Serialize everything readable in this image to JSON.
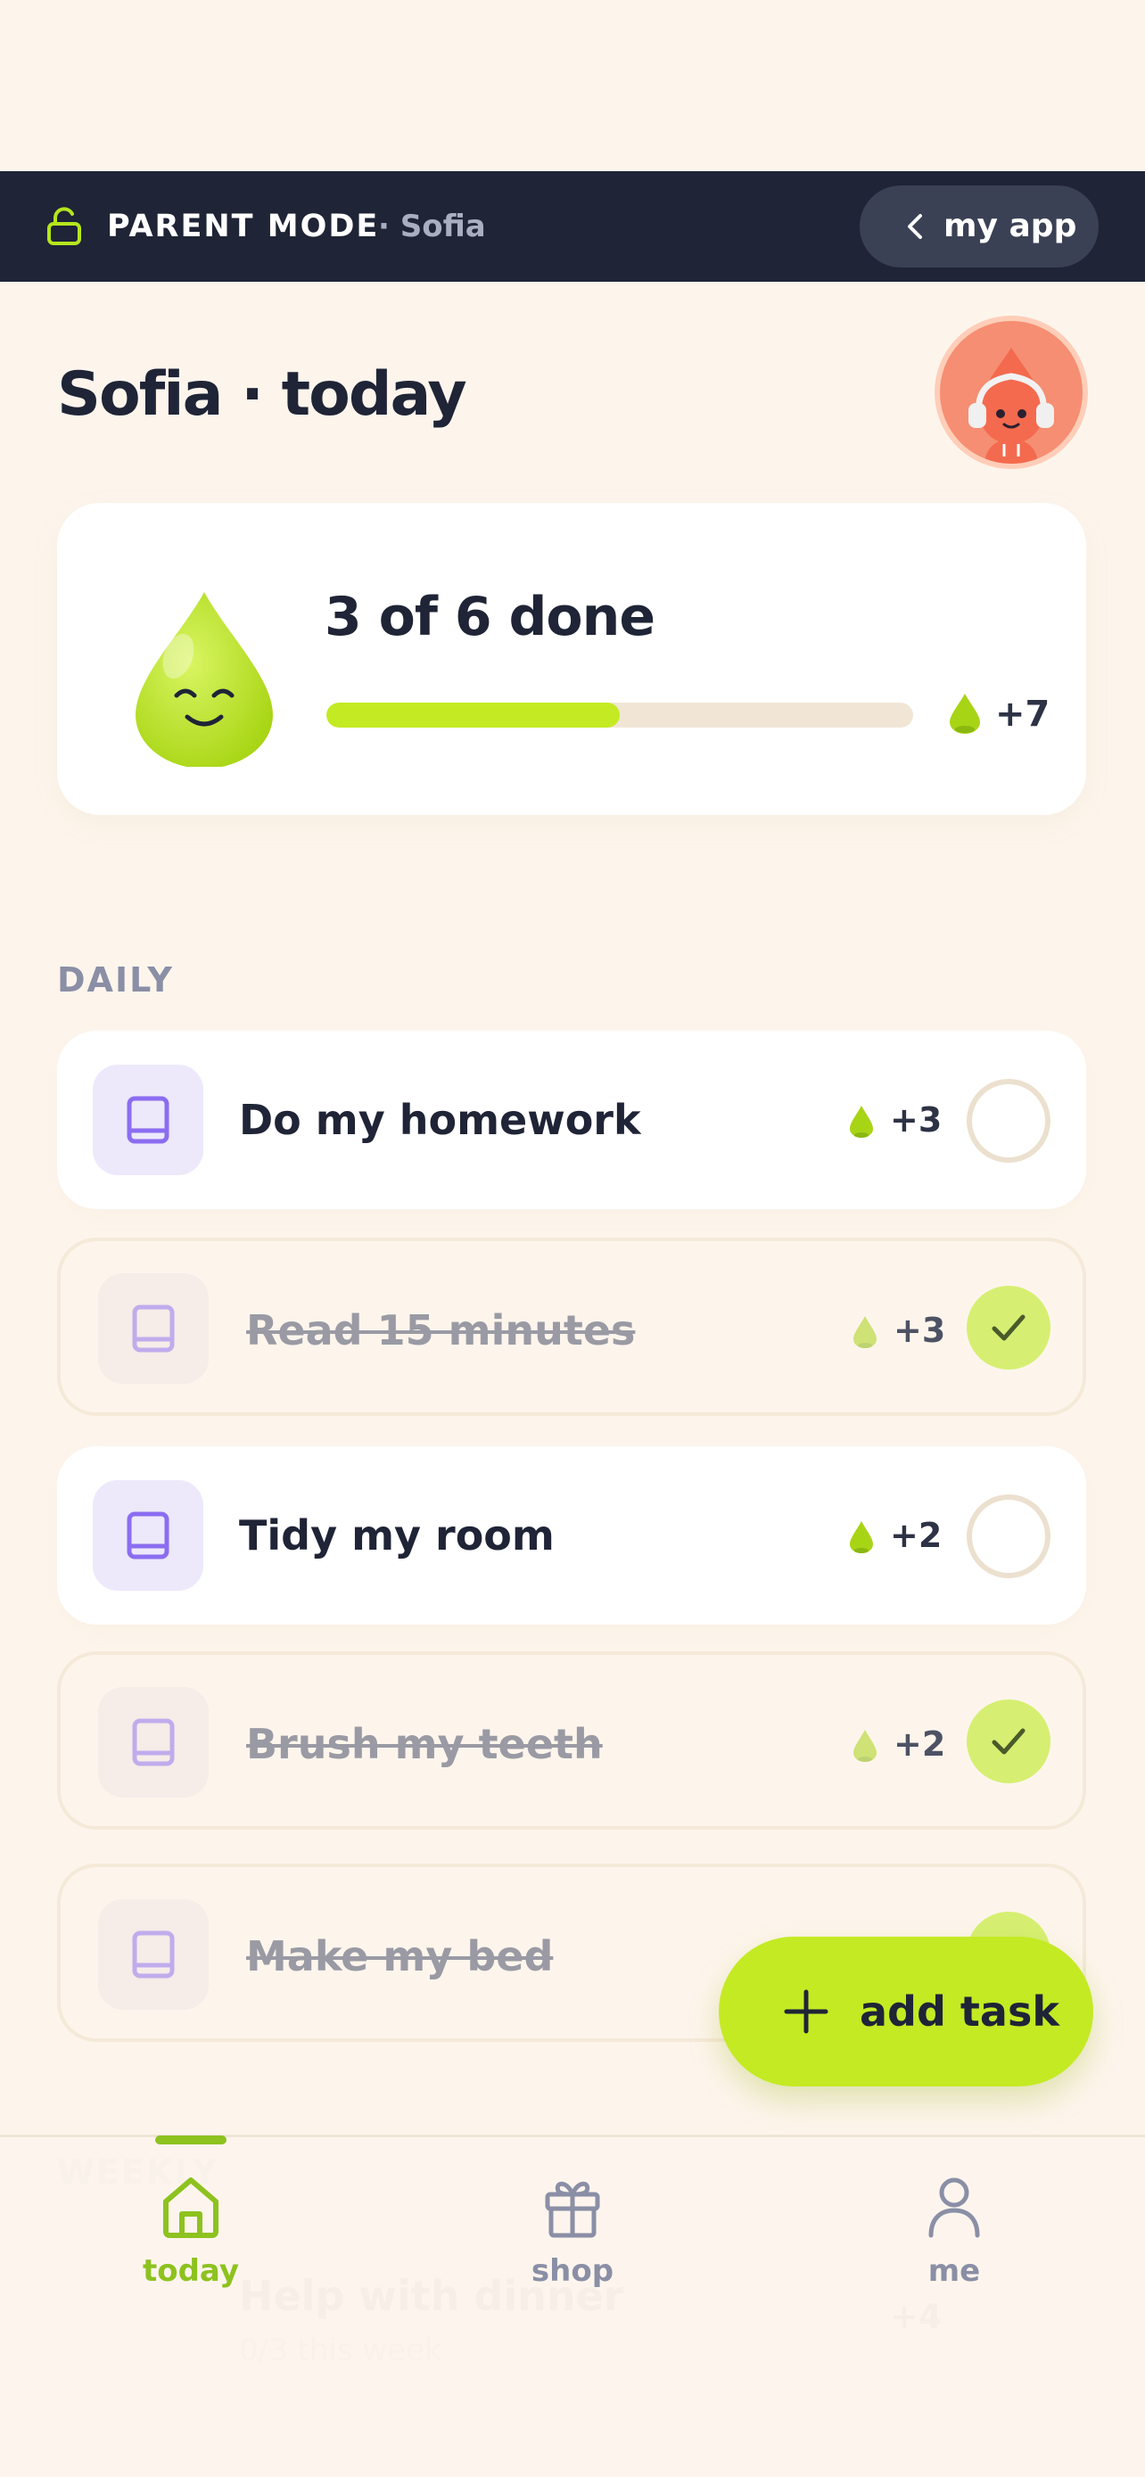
{
  "parent_bar": {
    "mode_label": "PARENT MODE",
    "child_label": "· Sofia",
    "my_app_label": "my app"
  },
  "header": {
    "title": "Sofia · today"
  },
  "progress": {
    "text": "3 of 6 done",
    "done": 3,
    "total": 6,
    "fraction": 0.5,
    "points_label": "+7"
  },
  "sections": {
    "daily": "DAILY",
    "weekly": "WEEKLY"
  },
  "tasks": [
    {
      "title": "Do my homework",
      "points": "+3",
      "done": false
    },
    {
      "title": "Read 15 minutes",
      "points": "+3",
      "done": true
    },
    {
      "title": "Tidy my room",
      "points": "+2",
      "done": false
    },
    {
      "title": "Brush my teeth",
      "points": "+2",
      "done": true
    },
    {
      "title": "Make my bed",
      "points": "",
      "done": true
    }
  ],
  "weekly_task": {
    "title": "Help with dinner",
    "subtitle": "0/3 this week",
    "points": "+4"
  },
  "fab": {
    "label": "add task"
  },
  "nav": {
    "today": "today",
    "shop": "shop",
    "me": "me",
    "active": "today"
  },
  "colors": {
    "accent": "#c4ea24",
    "nav_active": "#8dc21f",
    "dark_bar": "#1f2436",
    "background": "#fdf5ec"
  }
}
